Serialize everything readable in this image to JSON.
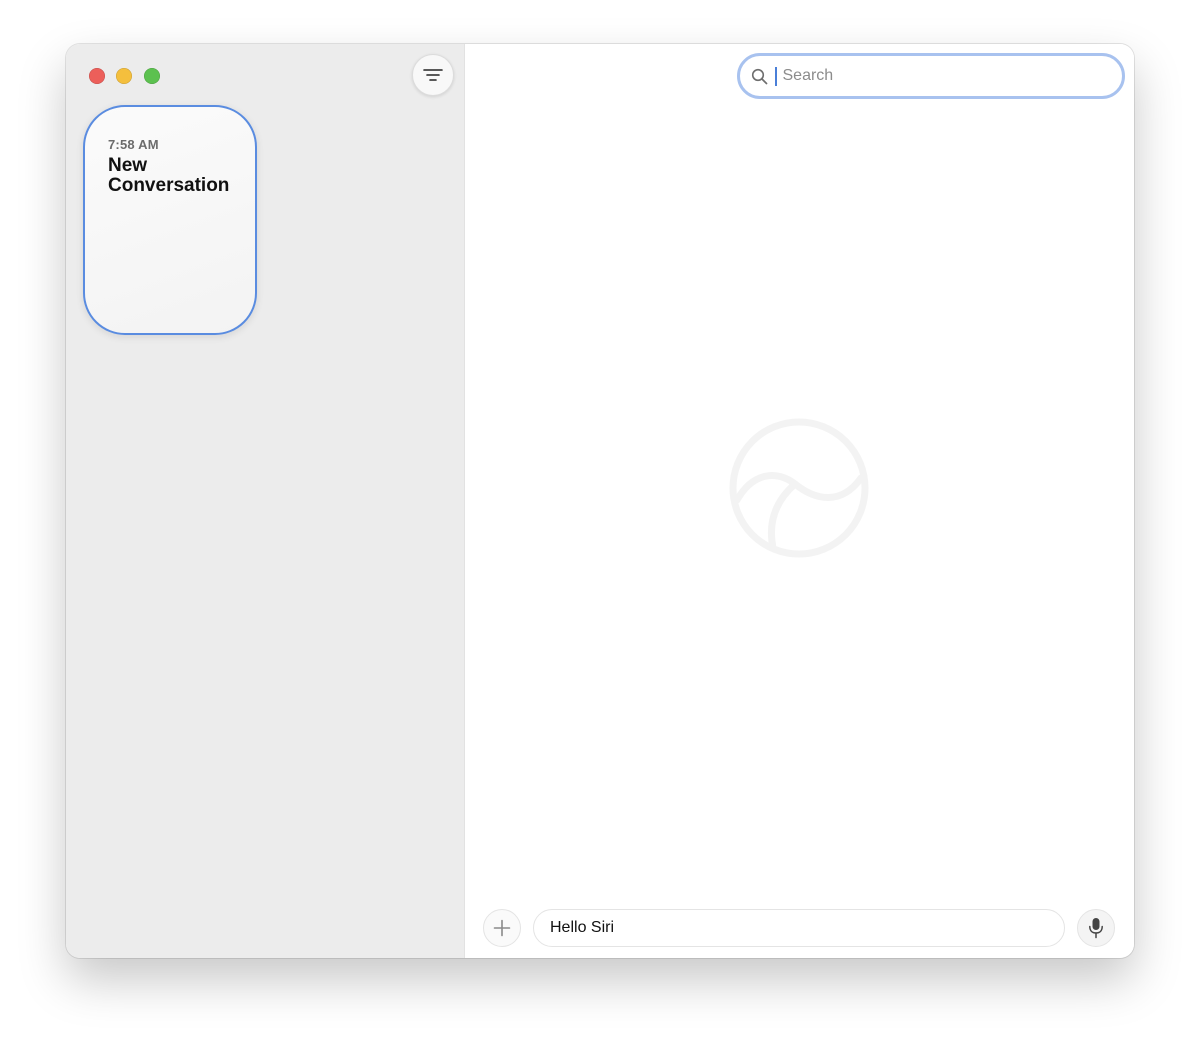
{
  "sidebar": {
    "conversations": [
      {
        "time": "7:58 AM",
        "title": "New Conversation",
        "selected": true
      }
    ]
  },
  "main": {
    "search": {
      "placeholder": "Search",
      "value": ""
    },
    "input": {
      "text": "Hello Siri"
    }
  },
  "icons": {
    "filter": "filter-lines-icon",
    "compose": "compose-icon",
    "search": "magnifying-glass-icon",
    "siri": "siri-logo-icon",
    "add": "plus-icon",
    "mic": "microphone-icon"
  },
  "colors": {
    "accent": "#5a8ce0",
    "search_focus": "#a8c2ef",
    "close": "#ec5f5a",
    "minimize": "#f4bf3d",
    "maximize": "#5cc14f",
    "sidebar_bg": "#ececec"
  }
}
